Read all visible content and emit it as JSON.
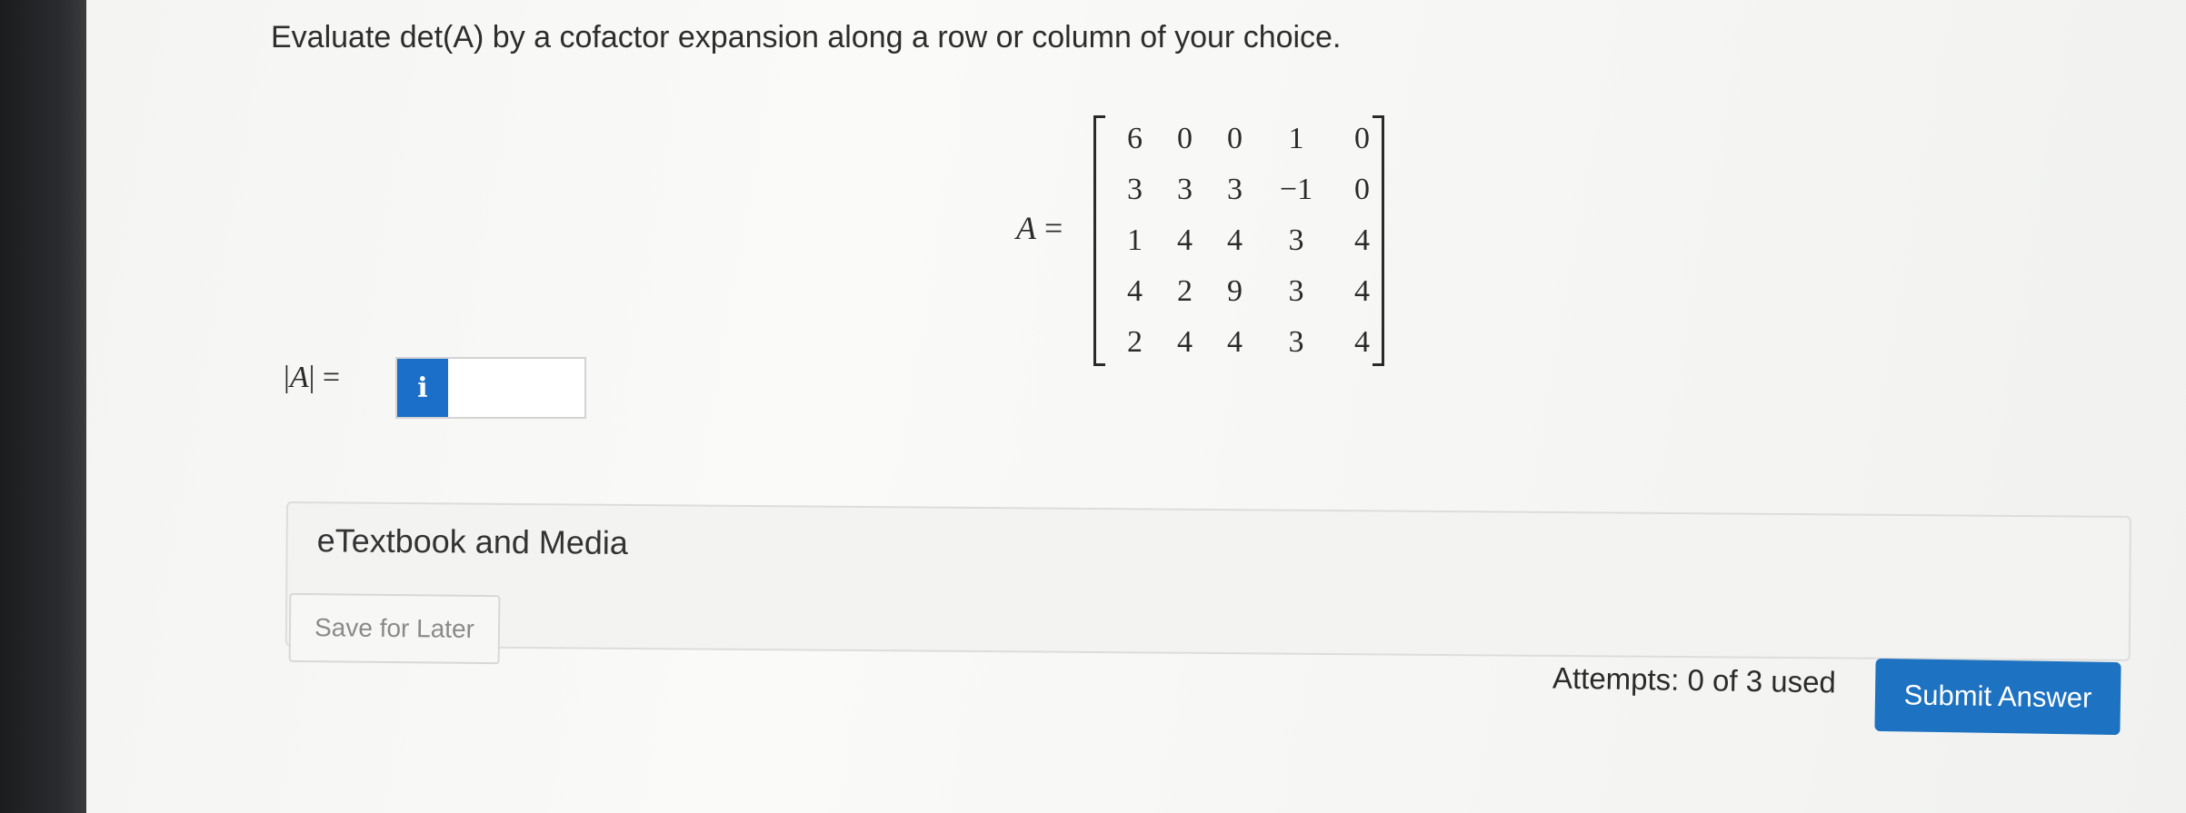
{
  "question": {
    "text": "Evaluate det(A) by a cofactor expansion along a row or column of your choice."
  },
  "matrix": {
    "variable": "A",
    "equals": "=",
    "rows": [
      [
        "6",
        "0",
        "0",
        "1",
        "0"
      ],
      [
        "3",
        "3",
        "3",
        "−1",
        "0"
      ],
      [
        "1",
        "4",
        "4",
        "3",
        "4"
      ],
      [
        "4",
        "2",
        "9",
        "3",
        "4"
      ],
      [
        "2",
        "4",
        "4",
        "3",
        "4"
      ]
    ]
  },
  "answer": {
    "label_open": "|",
    "label_var": "A",
    "label_close": "| =",
    "info_icon": "info-icon",
    "info_glyph": "i",
    "value": ""
  },
  "etextbook": {
    "label": "eTextbook and Media"
  },
  "actions": {
    "save_label": "Save for Later",
    "attempts_text": "Attempts: 0 of 3 used",
    "submit_label": "Submit Answer"
  },
  "colors": {
    "accent": "#1d72c2",
    "info_badge": "#1c6fc8"
  }
}
